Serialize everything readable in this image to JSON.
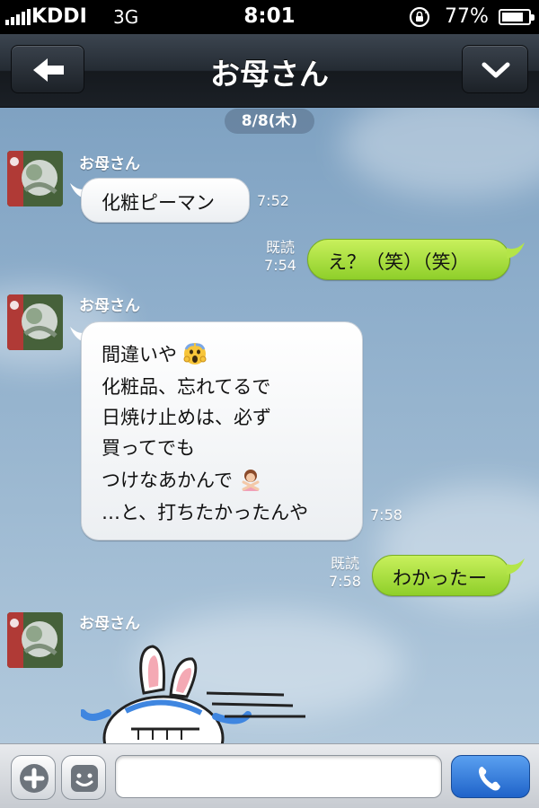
{
  "status_bar": {
    "carrier": "KDDI",
    "network": "3G",
    "time": "8:01",
    "battery_percent": "77%",
    "battery_level": 0.77
  },
  "nav": {
    "title": "お母さん",
    "back_icon": "back-arrow-icon",
    "menu_icon": "chevron-down-icon"
  },
  "chat": {
    "date_label": "8/8(木)",
    "read_label": "既読",
    "messages": [
      {
        "direction": "in",
        "sender": "お母さん",
        "lines": [
          "化粧ピーマン"
        ],
        "time": "7:52"
      },
      {
        "direction": "out",
        "lines": [
          "え？（笑）（笑）"
        ],
        "time": "7:54",
        "read": "既読"
      },
      {
        "direction": "in",
        "sender": "お母さん",
        "lines": [
          "間違いや",
          "化粧品、忘れてるで",
          "日焼け止めは、必ず",
          "買ってでも",
          "つけなあかんで",
          "…と、打ちたかったんや"
        ],
        "emoji": [
          "scream-face-icon",
          "no-gesture-woman-icon"
        ],
        "time": "7:58"
      },
      {
        "direction": "out",
        "lines": [
          "わかったー"
        ],
        "time": "7:58",
        "read": "既読"
      },
      {
        "direction": "in",
        "sender": "お母さん",
        "sticker": "crying-bunny-sticker"
      }
    ]
  },
  "input_bar": {
    "plus_icon": "plus-icon",
    "sticker_icon": "smiley-icon",
    "placeholder": "",
    "call_icon": "phone-icon"
  },
  "colors": {
    "outgoing_bubble": "#9fda36",
    "incoming_bubble": "#ffffff",
    "call_button": "#2f79dc",
    "nav_bar": "#232a32"
  }
}
